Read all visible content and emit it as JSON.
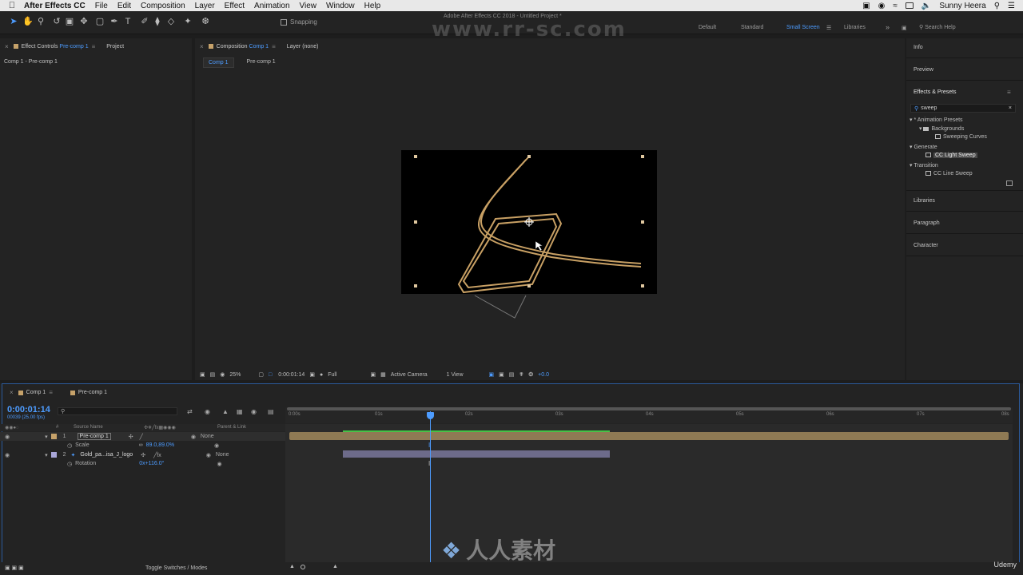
{
  "menubar": {
    "app_name": "After Effects CC",
    "items": [
      "File",
      "Edit",
      "Composition",
      "Layer",
      "Effect",
      "Animation",
      "View",
      "Window",
      "Help"
    ],
    "user": "Sunny Heera"
  },
  "toolbar": {
    "snapping_label": "Snapping",
    "doc_title": "Adobe After Effects CC 2018 - Untitled Project *",
    "watermark": "www.rr-sc.com",
    "workspaces": [
      "Default",
      "Standard",
      "Small Screen",
      "Libraries"
    ],
    "active_workspace": "Small Screen",
    "search_placeholder": "Search Help"
  },
  "left_panel": {
    "tab_effect_controls_prefix": "Effect Controls",
    "tab_effect_controls_target": "Pre-comp 1",
    "tab_project": "Project",
    "breadcrumb": "Comp 1 - Pre-comp 1"
  },
  "comp_panel": {
    "tab_composition_prefix": "Composition",
    "tab_composition_target": "Comp 1",
    "tab_layer": "Layer (none)",
    "subtabs": [
      "Comp 1",
      "Pre-comp 1"
    ],
    "zoom": "25%",
    "timecode": "0:00:01:14",
    "resolution": "Full",
    "camera": "Active Camera",
    "views": "1 View",
    "exposure": "+0.0"
  },
  "right_panel": {
    "info": "Info",
    "preview": "Preview",
    "effects_presets": "Effects & Presets",
    "search_value": "sweep",
    "tree": {
      "animation_presets": "* Animation Presets",
      "backgrounds": "Backgrounds",
      "sweeping_curves": "Sweeping Curves",
      "generate": "Generate",
      "cc_light_sweep": "CC Light Sweep",
      "transition": "Transition",
      "cc_line_sweep": "CC Line Sweep"
    },
    "libraries": "Libraries",
    "paragraph": "Paragraph",
    "character": "Character"
  },
  "timeline": {
    "tabs": [
      "Comp 1",
      "Pre-comp 1"
    ],
    "timecode": "0:00:01:14",
    "fps": "00039 (25.00 fps)",
    "col_source_name": "Source Name",
    "col_parent": "Parent & Link",
    "layers": [
      {
        "num": "1",
        "name": "Pre-comp 1",
        "parent": "None",
        "prop_name": "Scale",
        "prop_value": "89.0,89.0%"
      },
      {
        "num": "2",
        "name": "Gold_pa...isa_J_logo",
        "parent": "None",
        "prop_name": "Rotation",
        "prop_value": "0x+116.0°"
      }
    ],
    "ruler_ticks": [
      "0:00s",
      "01s",
      "02s",
      "03s",
      "04s",
      "05s",
      "06s",
      "07s",
      "08s"
    ],
    "toggle_label": "Toggle Switches / Modes",
    "watermark_cn": "人人素材",
    "brand": "Udemy"
  },
  "colors": {
    "accent": "#4d9cff",
    "layer1_bar": "#8f7a54",
    "layer2_bar": "#6d6b8a",
    "work_area": "#46c246",
    "label_tan": "#c6a26a",
    "label_lavender": "#a9a6d8"
  }
}
